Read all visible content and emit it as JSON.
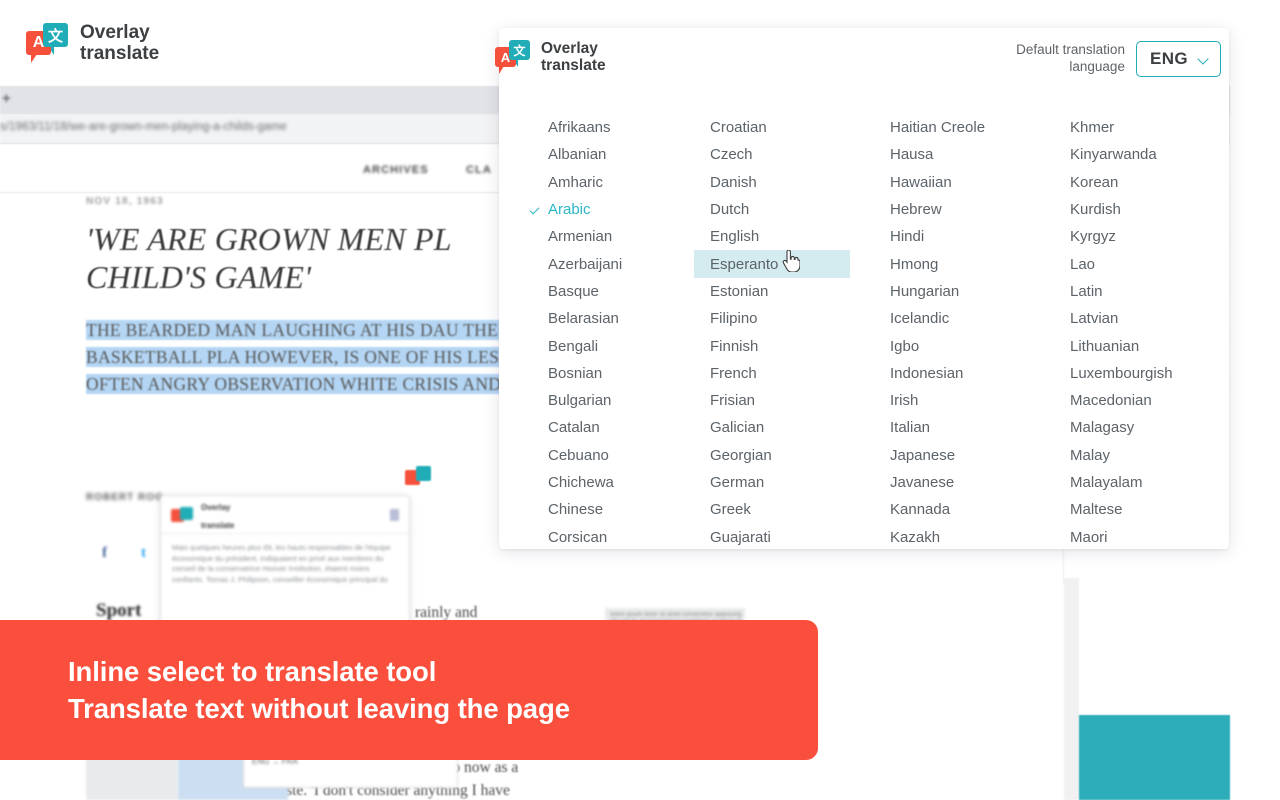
{
  "brand": {
    "name_line1": "Overlay",
    "name_line2": "translate",
    "logo_icon": "overlay-translate-logo",
    "bubble_red_glyph": "A",
    "bubble_teal_glyph": "文",
    "color_red": "#f4503c",
    "color_teal": "#21adb8"
  },
  "browser": {
    "new_tab_glyph": "+",
    "url": "s/1963/11/18/we-are-grown-men-playing-a-childs-game"
  },
  "site": {
    "nav_items": [
      "ARCHIVES",
      "CLA"
    ],
    "section_label": "Sport",
    "social": [
      "f",
      "t",
      "✉"
    ]
  },
  "article": {
    "date": "NOV 18, 1963",
    "headline_line1": "'WE ARE GROWN MEN PL",
    "headline_line2": "CHILD'S GAME'",
    "selected_paragraph": "THE BEARDED MAN LAUGHING AT HIS DAU THE MOST REMARKABLE BASKETBALL PLA HOWEVER, IS ONE OF HIS LESSER INTERES TRENCHANT, OFTEN ANGRY OBSERVATION WHITE CRISIS AND HIS ROLE IN IT.",
    "byline": "ROBERT ROG",
    "right_col_line1": "e up to now as a",
    "right_col_line2": "waste. 'I don't consider anything I have"
  },
  "inline_popup": {
    "title_line1": "Overlay",
    "title_line2": "translate",
    "copy_icon": "copy-icon",
    "body": "Mais quelques heures plus tôt, les hauts responsables de l'équipe économique du président, indiquaient en privé aux membres du conseil de la conservatrice Hoover Institution, étaient moins confiants. Tomas J. Philipson, conseiller économique principal du",
    "lang_chip": "ENG → FRA",
    "chip_arrow": "→"
  },
  "panel": {
    "default_lang_label": "Default translation\nlanguage",
    "selected_code": "ENG",
    "chevron_icon": "chevron-down-icon",
    "selected_language": "Arabic",
    "hovered_language": "Esperanto",
    "check_icon": "check-icon",
    "cursor_icon": "pointer-hand-cursor",
    "columns": [
      [
        "Afrikaans",
        "Albanian",
        "Amharic",
        "Arabic",
        "Armenian",
        "Azerbaijani",
        "Basque",
        "Belarasian",
        "Bengali",
        "Bosnian",
        "Bulgarian",
        "Catalan",
        "Cebuano",
        "Chichewa",
        "Chinese",
        "Corsican"
      ],
      [
        "Croatian",
        "Czech",
        "Danish",
        "Dutch",
        "English",
        "Esperanto",
        "Estonian",
        "Filipino",
        "Finnish",
        "French",
        "Frisian",
        "Galician",
        "Georgian",
        "German",
        "Greek",
        "Guajarati"
      ],
      [
        "Haitian Creole",
        "Hausa",
        "Hawaiian",
        "Hebrew",
        "Hindi",
        "Hmong",
        "Hungarian",
        "Icelandic",
        "Igbo",
        "Indonesian",
        "Irish",
        "Italian",
        "Japanese",
        "Javanese",
        "Kannada",
        "Kazakh"
      ],
      [
        "Khmer",
        "Kinyarwanda",
        "Korean",
        "Kurdish",
        "Kyrgyz",
        "Lao",
        "Latin",
        "Latvian",
        "Lithuanian",
        "Luxembourgish",
        "Macedonian",
        "Malagasy",
        "Malay",
        "Malayalam",
        "Maltese",
        "Maori"
      ]
    ]
  },
  "promo": {
    "line1": "Inline select to translate tool",
    "line2": "Translate text without leaving the page",
    "background_color": "#fa4f3c",
    "text_color": "#ffffff"
  },
  "accents": {
    "teal_block": "#1ca7b4",
    "selection_blue": "#aed3f4",
    "hover_teal": "#d4ecf0"
  }
}
